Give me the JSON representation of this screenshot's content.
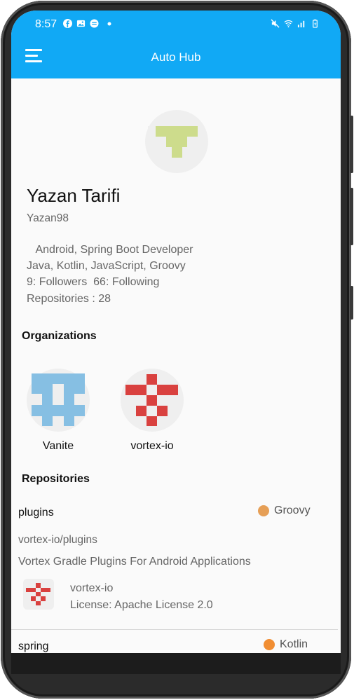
{
  "status_bar": {
    "time": "8:57",
    "left_icons": [
      "facebook-icon",
      "image-icon",
      "messenger-icon",
      "dot-icon"
    ],
    "right_icons": [
      "mute-icon",
      "wifi-icon",
      "signal-icon",
      "battery-icon"
    ]
  },
  "app_bar": {
    "title": "Auto Hub",
    "menu_icon": "hamburger-menu-icon",
    "color": "#11a9f5"
  },
  "profile": {
    "name": "Yazan Tarifi",
    "username": "Yazan98",
    "bio_line1": "   Android, Spring Boot Developer",
    "bio_line2": "Java, Kotlin, JavaScript, Groovy",
    "follow_line": "9: Followers  66: Following",
    "repos_line": "Repositories : 28"
  },
  "organizations": {
    "title": "Organizations",
    "items": [
      {
        "name": "Vanite"
      },
      {
        "name": "vortex-io"
      }
    ]
  },
  "repositories": {
    "title": "Repositories",
    "items": [
      {
        "name": "plugins",
        "language": "Groovy",
        "language_color": "#e69f56",
        "full_name": "vortex-io/plugins",
        "description": "Vortex Gradle Plugins For Android Applications",
        "owner": "vortex-io",
        "license": "License: Apache License 2.0"
      },
      {
        "name": "spring",
        "language": "Kotlin",
        "language_color": "#f18e33"
      }
    ]
  }
}
